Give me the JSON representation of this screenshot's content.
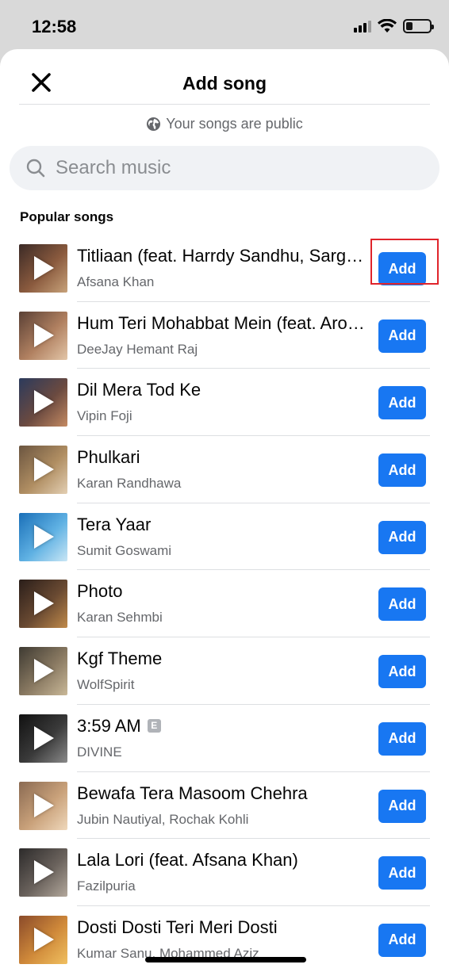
{
  "status_bar": {
    "time": "12:58"
  },
  "header": {
    "title": "Add song",
    "public_note": "Your songs are public"
  },
  "search": {
    "placeholder": "Search music",
    "value": ""
  },
  "section_title": "Popular songs",
  "add_label": "Add",
  "songs": [
    {
      "title": "Titliaan (feat. Harrdy Sandhu, Sargun Mehta)",
      "artist": "Afsana Khan",
      "explicit": false,
      "colors": [
        "#3b2a26",
        "#8a5a3e",
        "#c7a27a"
      ]
    },
    {
      "title": "Hum Teri Mohabbat Mein (feat. Arohi Sharma)",
      "artist": "DeeJay Hemant Raj",
      "explicit": false,
      "colors": [
        "#5a4035",
        "#b08060",
        "#e3c6a8"
      ]
    },
    {
      "title": "Dil Mera Tod Ke",
      "artist": "Vipin Foji",
      "explicit": false,
      "colors": [
        "#2b3a5c",
        "#6b4a40",
        "#c48a62"
      ]
    },
    {
      "title": "Phulkari",
      "artist": "Karan Randhawa",
      "explicit": false,
      "colors": [
        "#6b5540",
        "#b08e62",
        "#e3cfb3"
      ]
    },
    {
      "title": "Tera Yaar",
      "artist": "Sumit Goswami",
      "explicit": false,
      "colors": [
        "#1a6fb8",
        "#5fb1e3",
        "#c9e6f5"
      ]
    },
    {
      "title": "Photo",
      "artist": "Karan Sehmbi",
      "explicit": false,
      "colors": [
        "#2a1e1a",
        "#6a4a32",
        "#c08a4a"
      ]
    },
    {
      "title": "Kgf Theme",
      "artist": "WolfSpirit",
      "explicit": false,
      "colors": [
        "#3e3a32",
        "#8a7a62",
        "#c9b898"
      ]
    },
    {
      "title": "3:59 AM",
      "artist": "DIVINE",
      "explicit": true,
      "explicit_label": "E",
      "colors": [
        "#111111",
        "#3a3a3a",
        "#8a8a8a"
      ]
    },
    {
      "title": "Bewafa Tera Masoom Chehra",
      "artist": "Jubin Nautiyal, Rochak Kohli",
      "explicit": false,
      "colors": [
        "#8a6a52",
        "#c9a17a",
        "#efd8bb"
      ]
    },
    {
      "title": "Lala Lori (feat. Afsana Khan)",
      "artist": "Fazilpuria",
      "explicit": false,
      "colors": [
        "#2c2a2a",
        "#6a625c",
        "#b3a89c"
      ]
    },
    {
      "title": "Dosti Dosti Teri Meri Dosti",
      "artist": "Kumar Sanu, Mohammed Aziz",
      "explicit": false,
      "colors": [
        "#8a4a2a",
        "#d08a3a",
        "#f0c060"
      ]
    }
  ]
}
